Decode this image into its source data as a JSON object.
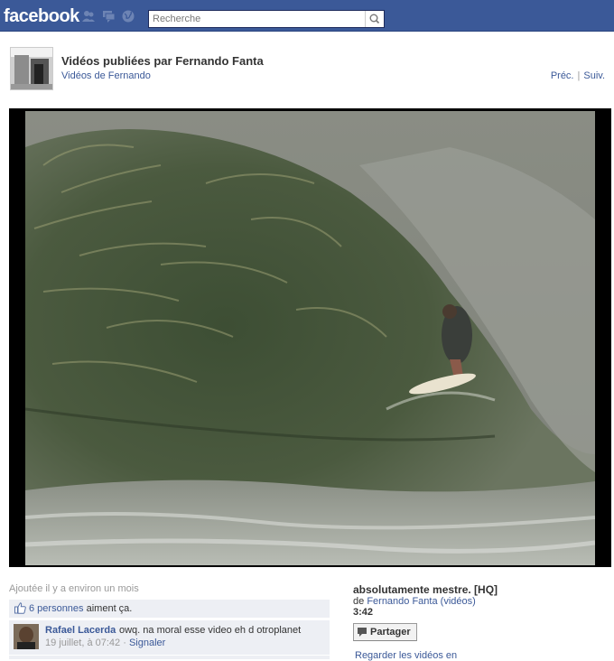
{
  "topbar": {
    "logo": "facebook",
    "search": {
      "placeholder": "Recherche"
    },
    "icons": [
      "friend-requests-icon",
      "messages-icon",
      "notifications-globe-icon"
    ]
  },
  "header": {
    "title": "Vidéos publiées par Fernando Fanta",
    "sublink": "Vidéos de Fernando",
    "prev": "Préc.",
    "separator": "|",
    "next": "Suiv."
  },
  "video": {
    "description": "surfer-riding-large-wave",
    "title": "absolutamente mestre. [HQ]",
    "by_prefix": "de",
    "author": "Fernando Fanta",
    "videos_link": "(vidéos)",
    "duration": "3:42"
  },
  "meta": {
    "added": "Ajoutée il y a environ un mois",
    "likes_link": "6 personnes",
    "likes_suffix": " aiment ça."
  },
  "comment": {
    "author": "Rafael Lacerda",
    "text": "owq. na moral esse video eh d otroplanet",
    "timestamp": "19 juillet, à 07:42",
    "separator": "·",
    "report": "Signaler"
  },
  "actions": {
    "share_label": "Partager",
    "watch_link": "Regarder les vidéos en"
  },
  "colors": {
    "topbar": "#3b5998",
    "link": "#3b5998",
    "panel": "#edeff4"
  }
}
